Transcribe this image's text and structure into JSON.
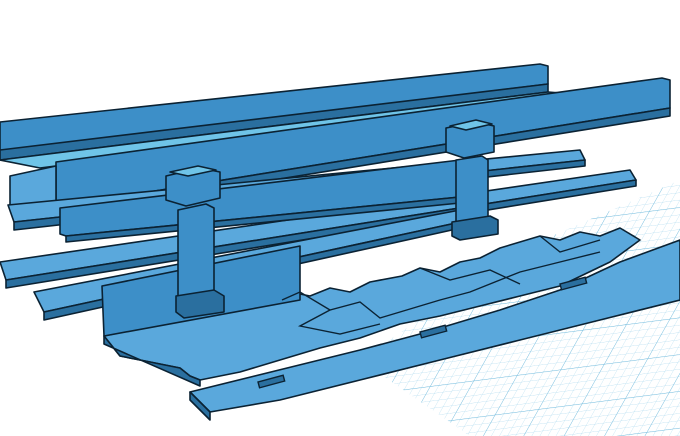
{
  "viewport": {
    "type": "3d-modeling-canvas",
    "background": "#ffffff",
    "grid": {
      "shown": true,
      "color": "#9fd3ea",
      "major_color": "#6fb9dc"
    },
    "model": {
      "fill": "#3d8fc8",
      "fill_light": "#5aa8dc",
      "fill_dark": "#2a6f9f",
      "outline": "#0b2233",
      "parts": [
        "long-back-rail-top",
        "long-back-rail-upright",
        "long-front-rail",
        "left-bracket-post",
        "right-bracket-post",
        "flat-strip-1",
        "flat-strip-2",
        "flat-strip-3",
        "base-plate-puzzle",
        "right-plate-puzzle"
      ]
    }
  }
}
